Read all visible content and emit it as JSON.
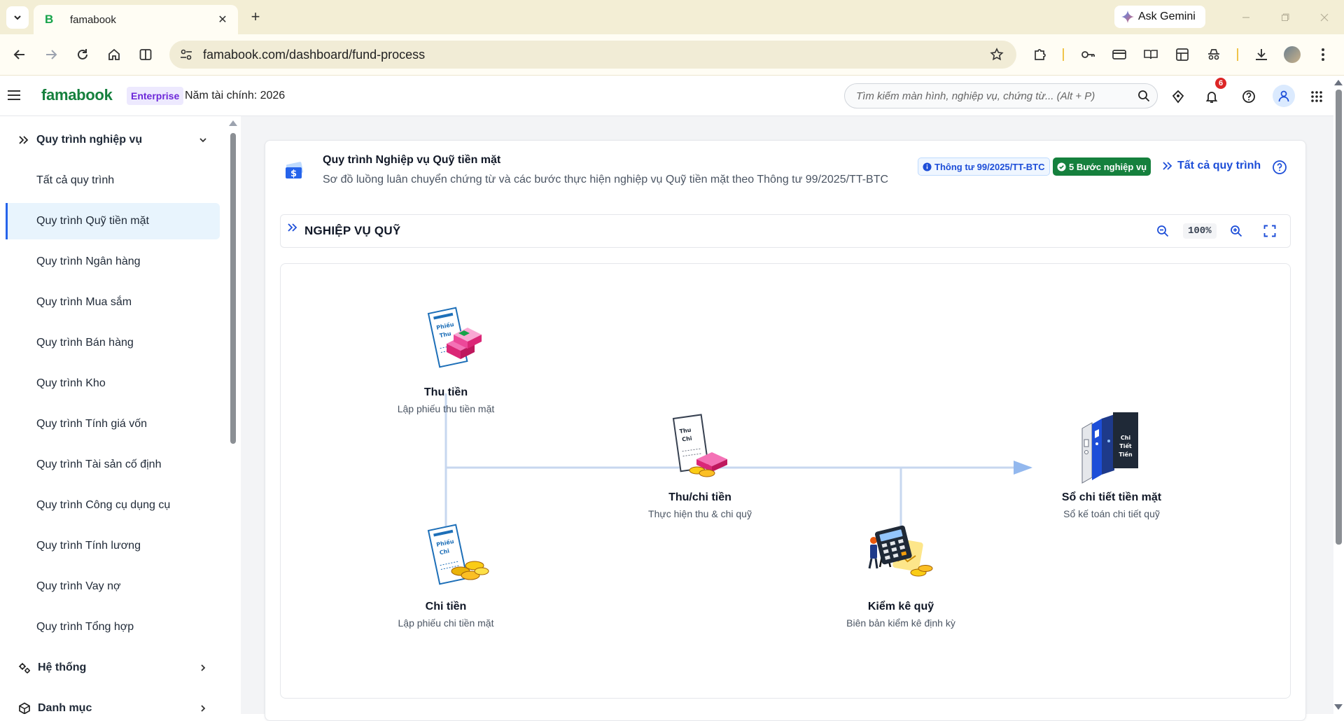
{
  "browser": {
    "tab_title": "famabook",
    "ask_gemini": "Ask Gemini",
    "url": "famabook.com/dashboard/fund-process",
    "window_controls": [
      "minimize-icon",
      "restore-icon",
      "close-icon"
    ]
  },
  "header": {
    "brand": "famabook",
    "plan_badge": "Enterprise",
    "fiscal_year": "Năm tài chính: 2026",
    "search_placeholder": "Tìm kiếm màn hình, nghiệp vụ, chứng từ... (Alt + P)",
    "notification_count": "6"
  },
  "sidebar": {
    "group_process": "Quy trình nghiệp vụ",
    "items": [
      {
        "label": "Tất cả quy trình"
      },
      {
        "label": "Quy trình Quỹ tiền mặt",
        "active": true
      },
      {
        "label": "Quy trình Ngân hàng"
      },
      {
        "label": "Quy trình Mua sắm"
      },
      {
        "label": "Quy trình Bán hàng"
      },
      {
        "label": "Quy trình Kho"
      },
      {
        "label": "Quy trình Tính giá vốn"
      },
      {
        "label": "Quy trình Tài sản cố định"
      },
      {
        "label": "Quy trình Công cụ dụng cụ"
      },
      {
        "label": "Quy trình Tính lương"
      },
      {
        "label": "Quy trình Vay nợ"
      },
      {
        "label": "Quy trình Tổng hợp"
      }
    ],
    "group_system": "Hệ thống",
    "group_catalog": "Danh mục"
  },
  "card": {
    "title": "Quy trình Nghiệp vụ Quỹ tiền mặt",
    "subtitle": "Sơ đồ luồng luân chuyển chứng từ và các bước thực hiện nghiệp vụ Quỹ tiền mặt theo Thông tư 99/2025/TT-BTC",
    "badge_circular": "Thông tư 99/2025/TT-BTC",
    "badge_steps": "5 Bước nghiệp vụ",
    "all_processes": "Tất cả quy trình"
  },
  "section": {
    "title": "NGHIỆP VỤ QUỸ",
    "zoom": "100%"
  },
  "flow": {
    "nodes": [
      {
        "title": "Thu tiền",
        "desc": "Lập phiếu thu tiền mặt",
        "doc_line1": "Phiếu",
        "doc_line2": "Thu"
      },
      {
        "title": "Chi tiền",
        "desc": "Lập phiếu chi tiền mặt",
        "doc_line1": "Phiếu",
        "doc_line2": "Chi"
      },
      {
        "title": "Thu/chi tiền",
        "desc": "Thực hiện thu & chi quỹ",
        "doc_line1": "Thu",
        "doc_line2": "Chi"
      },
      {
        "title": "Kiểm kê quỹ",
        "desc": "Biên bản kiểm kê định kỳ"
      },
      {
        "title": "Sổ chi tiết tiền mặt",
        "desc": "Sổ kế toán chi tiết quỹ",
        "book_line1": "Chi",
        "book_line2": "Tiết",
        "book_line3": "Tiền"
      }
    ]
  },
  "colors": {
    "brand": "#15803d",
    "accent": "#2563eb",
    "connector": "#c7d7ef",
    "arrow": "#93b8ee"
  }
}
